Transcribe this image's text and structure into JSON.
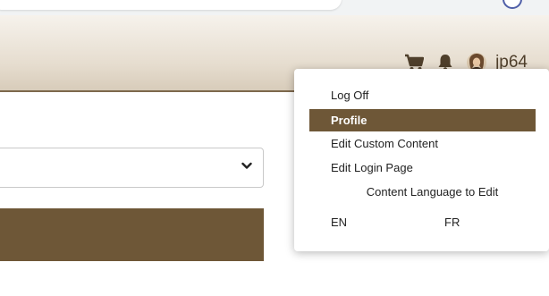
{
  "header": {
    "username": "jp64",
    "icons": [
      "cart-icon",
      "bell-icon",
      "user-avatar"
    ]
  },
  "user_menu": {
    "items": [
      {
        "label": "Log Off",
        "active": false
      },
      {
        "label": "Profile",
        "active": true
      },
      {
        "label": "Edit Custom Content",
        "active": false
      },
      {
        "label": "Edit Login Page",
        "active": false
      }
    ],
    "language_heading": "Content Language to Edit",
    "languages": [
      "EN",
      "FR"
    ]
  },
  "colors": {
    "brand_brown": "#6e5737",
    "header_text": "#4f3f2b"
  }
}
